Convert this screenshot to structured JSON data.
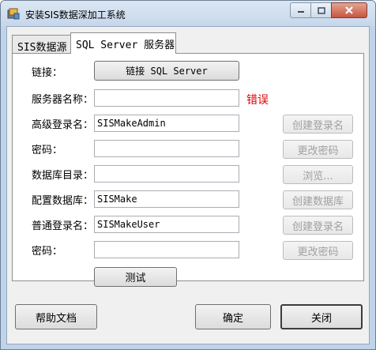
{
  "window": {
    "title": "安装SIS数据深加工系统"
  },
  "tabs": [
    {
      "label": "SIS数据源"
    },
    {
      "label": "SQL Server 服务器"
    }
  ],
  "form": {
    "connect_label": "链接：",
    "connect_button": "链接 SQL Server",
    "server_name_label": "服务器名称：",
    "server_name_value": "",
    "error_text": "错误",
    "admin_login_label": "高级登录名：",
    "admin_login_value": "SISMakeAdmin",
    "create_login_button": "创建登录名",
    "password1_label": "密码：",
    "password1_value": "",
    "change_password_button": "更改密码",
    "db_dir_label": "数据库目录：",
    "db_dir_value": "",
    "browse_button": "浏览...",
    "config_db_label": "配置数据库：",
    "config_db_value": "SISMake",
    "create_db_button": "创建数据库",
    "user_login_label": "普通登录名：",
    "user_login_value": "SISMakeUser",
    "create_login2_button": "创建登录名",
    "password2_label": "密码：",
    "password2_value": "",
    "change_password2_button": "更改密码",
    "test_button": "测试"
  },
  "footer": {
    "help_button": "帮助文档",
    "ok_button": "确定",
    "close_button": "关闭"
  },
  "colors": {
    "error": "#e00000",
    "frame": "#bfd3ea"
  }
}
